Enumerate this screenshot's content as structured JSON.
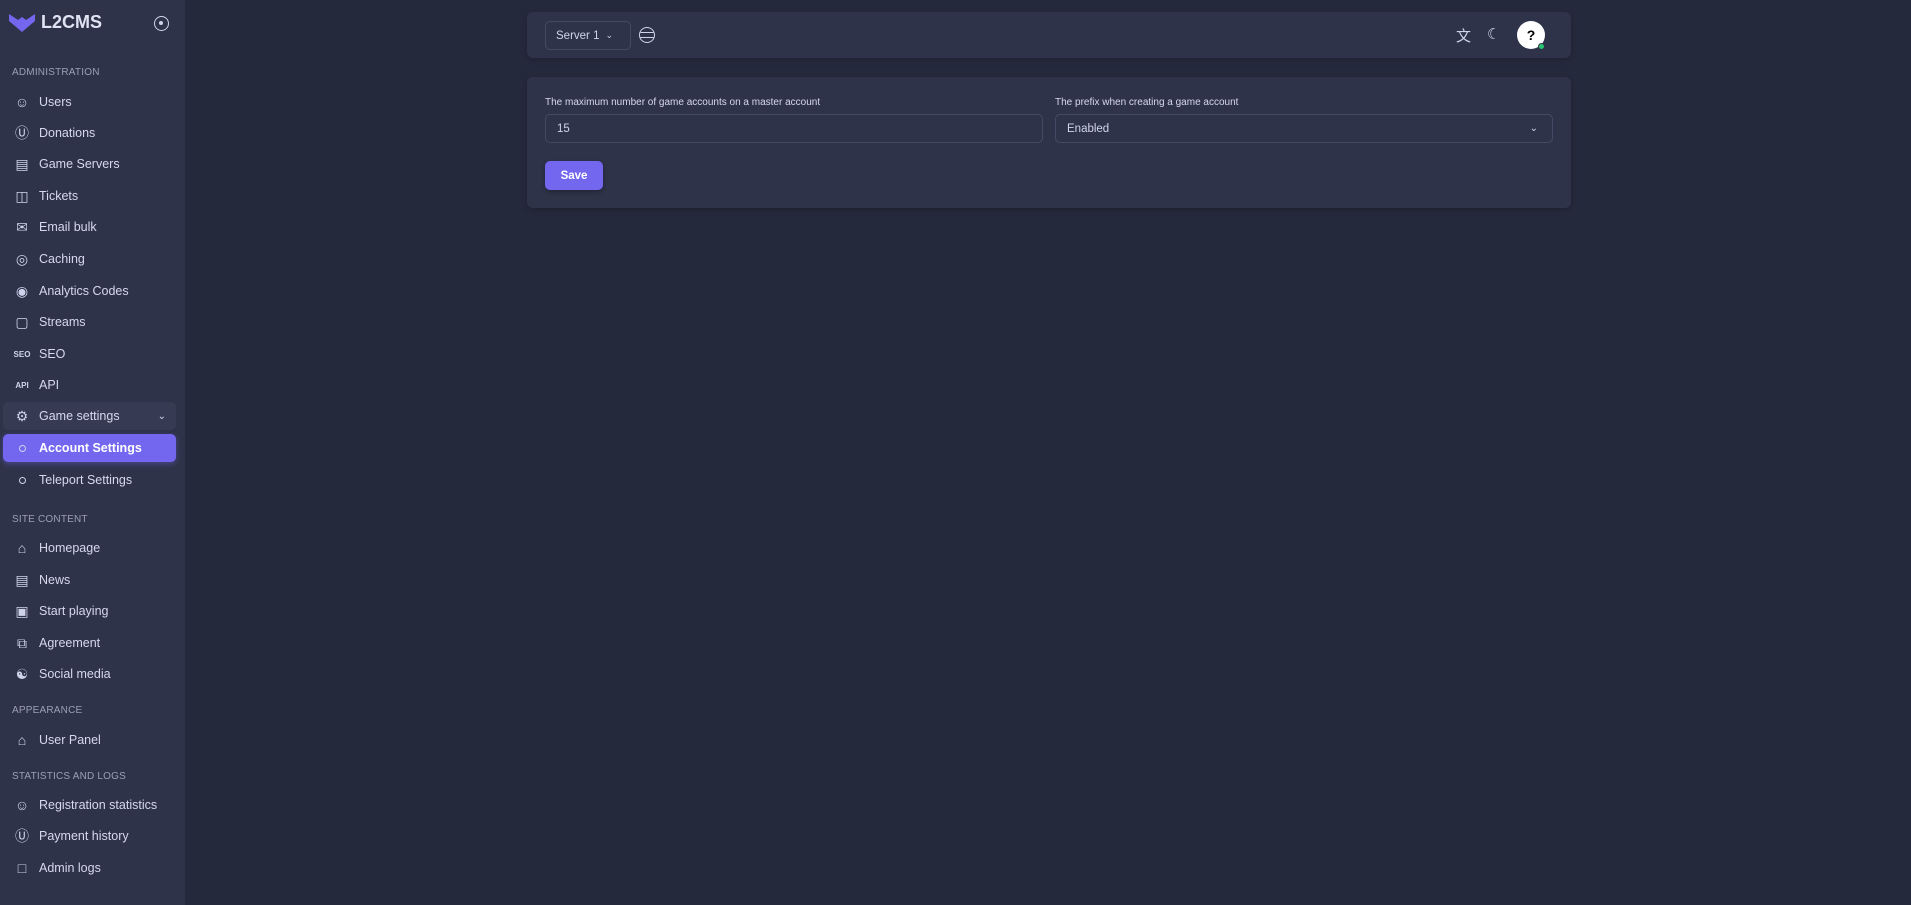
{
  "app": {
    "name": "L2CMS",
    "accent": "#7367f0"
  },
  "sidebar": {
    "sections": [
      {
        "title": "ADMINISTRATION",
        "items": [
          {
            "label": "Users",
            "icon": "users-icon"
          },
          {
            "label": "Donations",
            "icon": "dollar-circle-icon"
          },
          {
            "label": "Game Servers",
            "icon": "server-icon"
          },
          {
            "label": "Tickets",
            "icon": "ticket-icon"
          },
          {
            "label": "Email bulk",
            "icon": "mail-icon"
          },
          {
            "label": "Caching",
            "icon": "cache-icon"
          },
          {
            "label": "Analytics Codes",
            "icon": "analytics-icon"
          },
          {
            "label": "Streams",
            "icon": "twitch-icon"
          },
          {
            "label": "SEO",
            "icon": "seo-icon",
            "glyph": "SEO"
          },
          {
            "label": "API",
            "icon": "api-icon",
            "glyph": "API"
          },
          {
            "label": "Game settings",
            "icon": "gear-icon"
          },
          {
            "label": "Account Settings",
            "icon": "circle-icon"
          },
          {
            "label": "Teleport Settings",
            "icon": "circle-icon"
          }
        ]
      },
      {
        "title": "SITE CONTENT",
        "items": [
          {
            "label": "Homepage",
            "icon": "home-icon"
          },
          {
            "label": "News",
            "icon": "news-icon"
          },
          {
            "label": "Start playing",
            "icon": "play-icon"
          },
          {
            "label": "Agreement",
            "icon": "copy-icon"
          },
          {
            "label": "Social media",
            "icon": "share-icon"
          }
        ]
      },
      {
        "title": "APPEARANCE",
        "items": [
          {
            "label": "User Panel",
            "icon": "home-icon"
          }
        ]
      },
      {
        "title": "STATISTICS AND LOGS",
        "items": [
          {
            "label": "Registration statistics",
            "icon": "user-check-icon"
          },
          {
            "label": "Payment history",
            "icon": "dollar-circle-icon"
          },
          {
            "label": "Admin logs",
            "icon": "file-icon"
          }
        ]
      }
    ]
  },
  "topbar": {
    "server_select": "Server 1",
    "avatar_glyph": "?"
  },
  "form": {
    "max_accounts_label": "The maximum number of game accounts on a master account",
    "max_accounts_value": "15",
    "prefix_label": "The prefix when creating a game account",
    "prefix_value": "Enabled",
    "save_label": "Save"
  }
}
